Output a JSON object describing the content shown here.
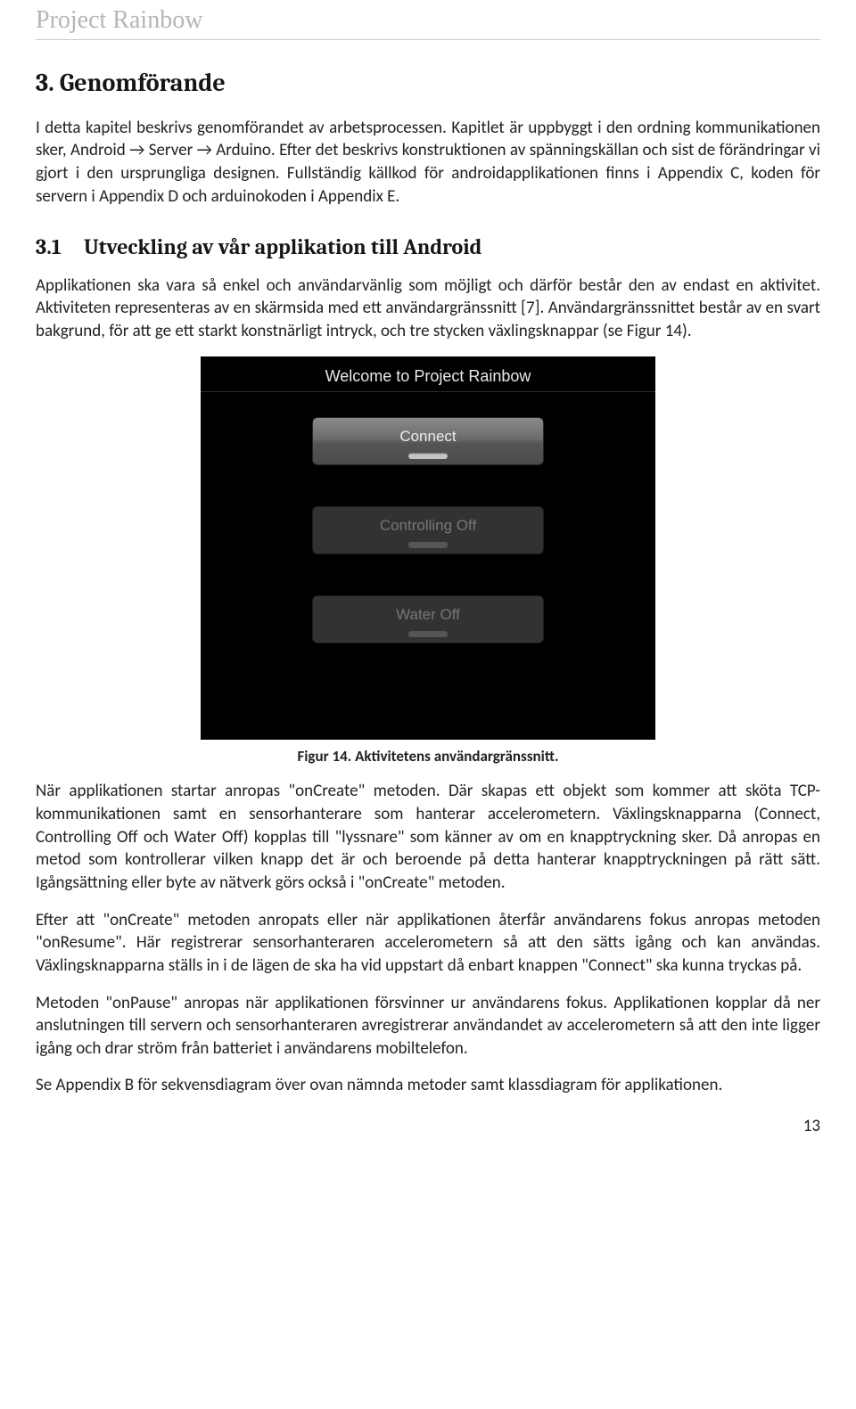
{
  "header": {
    "title": "Project Rainbow"
  },
  "section": {
    "num": "3.",
    "title": "Genomförande",
    "p1": "I detta kapitel beskrivs genomförandet av arbetsprocessen.  Kapitlet är uppbyggt i den ordning kommunikationen sker, Android → Server → Arduino. Efter det beskrivs konstruktionen av spänningskällan och sist de förändringar vi gjort i den ursprungliga designen. Fullständig källkod för androidapplikationen finns i Appendix C, koden för servern i Appendix D och arduinokoden i Appendix E."
  },
  "subsection": {
    "num": "3.1",
    "title": "Utveckling av vår applikation till Android",
    "p1": "Applikationen ska vara så enkel och användarvänlig som möjligt och därför består den av endast en aktivitet. Aktiviteten representeras av en skärmsida med ett användargränssnitt [7]. Användargränssnittet består av en svart bakgrund, för att ge ett starkt konstnärligt intryck, och tre stycken växlingsknappar (se Figur 14)."
  },
  "screenshot": {
    "title": "Welcome to Project Rainbow",
    "btn1": "Connect",
    "btn2": "Controlling Off",
    "btn3": "Water Off"
  },
  "caption": "Figur 14. Aktivitetens användargränssnitt.",
  "body": {
    "p2": "När applikationen startar anropas \"onCreate\" metoden. Där skapas ett objekt som kommer att sköta TCP-kommunikationen samt en sensorhanterare som hanterar accelerometern.  Växlingsknapparna (Connect, Controlling Off och Water Off) kopplas till \"lyssnare\" som känner av om en knapptryckning sker. Då anropas en metod som kontrollerar vilken knapp det är och beroende på detta hanterar knapptryckningen på rätt sätt. Igångsättning eller byte av nätverk görs också i \"onCreate\" metoden.",
    "p3": "Efter att \"onCreate\" metoden anropats eller när applikationen återfår användarens fokus anropas metoden \"onResume\". Här registrerar sensorhanteraren accelerometern så att den sätts igång och kan användas. Växlingsknapparna ställs in i de lägen de ska ha vid uppstart då enbart knappen \"Connect\" ska kunna tryckas på.",
    "p4": "Metoden \"onPause\" anropas när applikationen försvinner ur användarens fokus. Applikationen kopplar då ner anslutningen till servern och sensorhanteraren avregistrerar användandet av accelerometern så att den inte ligger igång och drar ström från batteriet i användarens mobiltelefon.",
    "p5": "Se Appendix B för sekvensdiagram över ovan nämnda metoder samt klassdiagram för applikationen."
  },
  "page": "13"
}
